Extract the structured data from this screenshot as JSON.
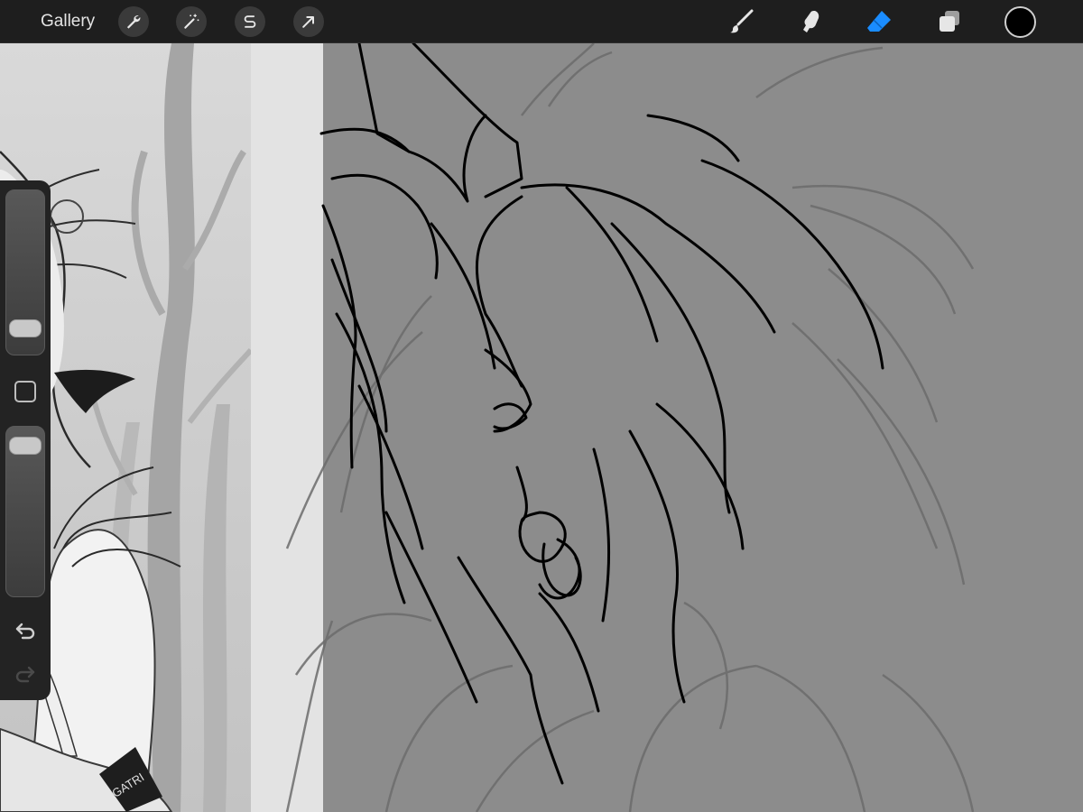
{
  "topbar": {
    "gallery_label": "Gallery",
    "left_tools": [
      {
        "name": "actions",
        "icon": "wrench-icon"
      },
      {
        "name": "adjustments",
        "icon": "magic-wand-icon"
      },
      {
        "name": "selection",
        "icon": "selection-s-icon"
      },
      {
        "name": "transform",
        "icon": "arrow-cursor-icon"
      }
    ],
    "right_tools": [
      {
        "name": "brush",
        "icon": "brush-icon",
        "active": false
      },
      {
        "name": "smudge",
        "icon": "smudge-finger-icon",
        "active": false
      },
      {
        "name": "eraser",
        "icon": "eraser-icon",
        "active": true
      },
      {
        "name": "layers",
        "icon": "layers-icon",
        "active": false
      }
    ],
    "current_color": "#000000",
    "active_tool_color": "#1a8cff"
  },
  "sidebar": {
    "brush_size_level": 0.1,
    "opacity_level": 0.95,
    "modify_icon": "square-outline-icon",
    "undo_icon": "undo-arrow-icon",
    "redo_icon": "redo-arrow-icon",
    "redo_enabled": false
  },
  "reference": {
    "badge_text": "GATRI"
  },
  "canvas": {
    "background": "#8c8c8c",
    "line_color": "#000000",
    "sketch_color": "#6e6e6e"
  }
}
